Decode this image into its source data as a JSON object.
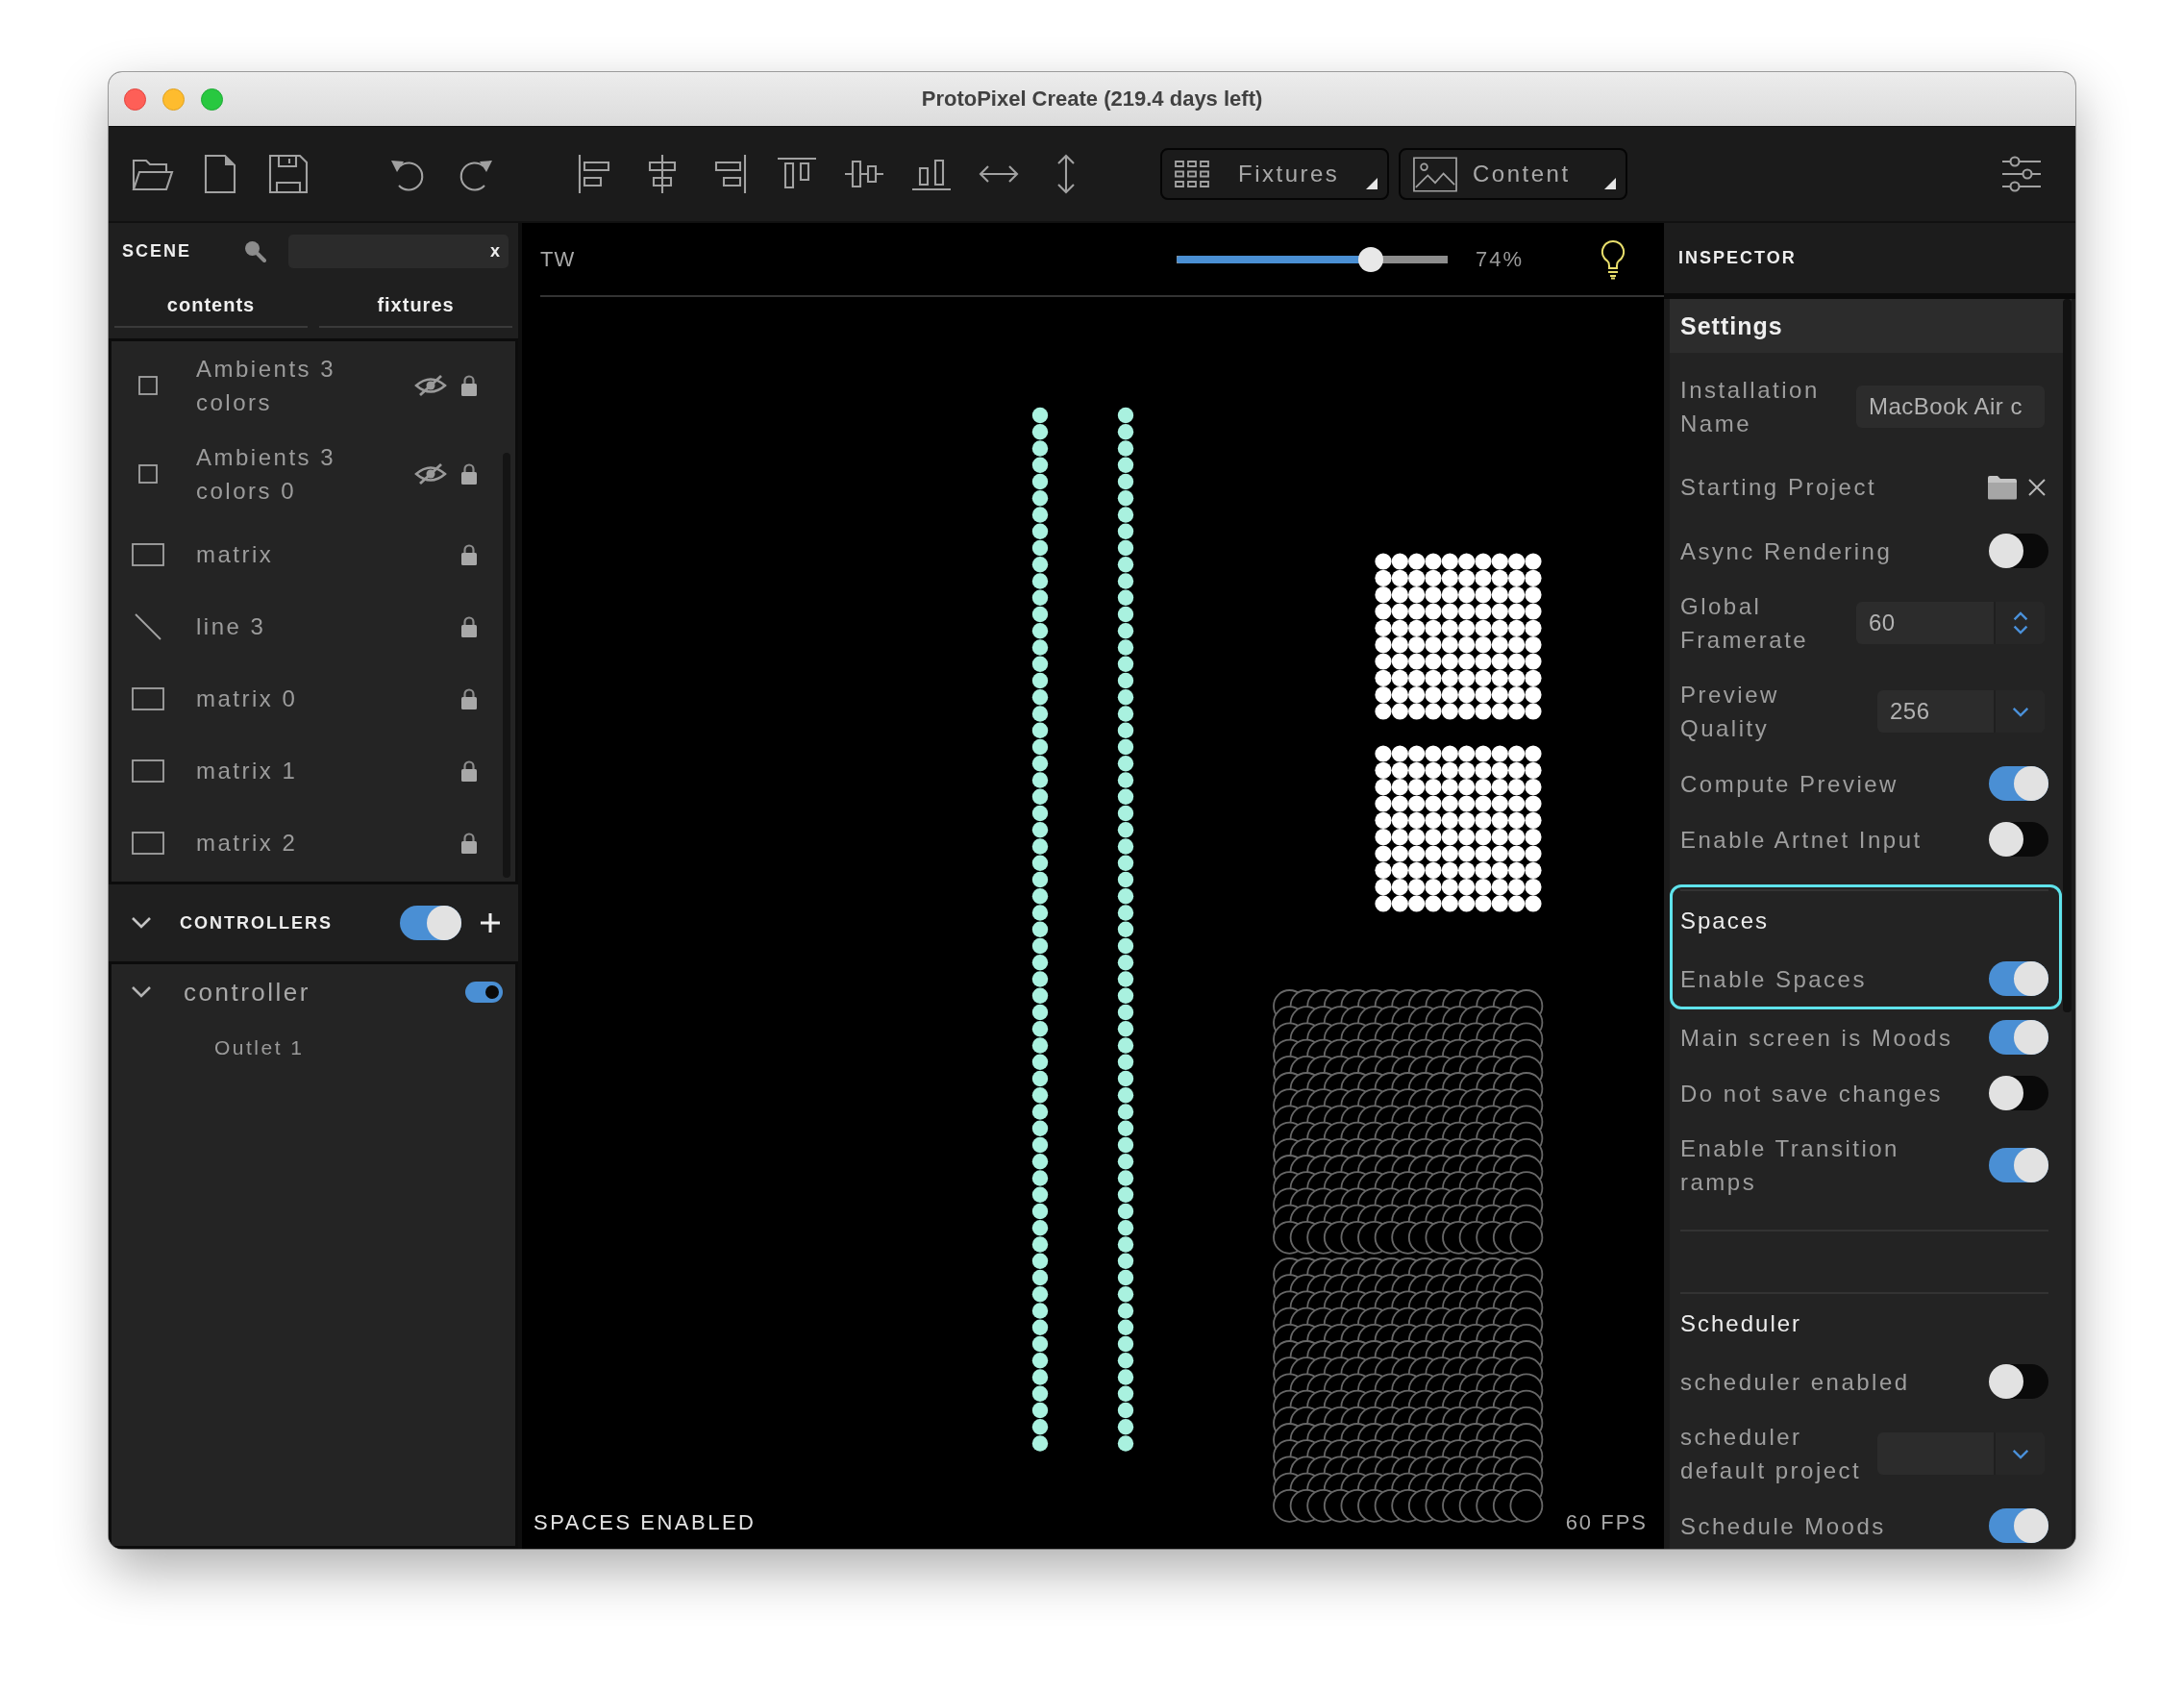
{
  "window": {
    "title": "ProtoPixel Create (219.4 days left)"
  },
  "toolbar": {
    "menus": [
      {
        "label": "Fixtures",
        "kind": "fixtures"
      },
      {
        "label": "Content",
        "kind": "content"
      }
    ]
  },
  "scene": {
    "title": "SCENE",
    "search": {
      "clear": "x"
    },
    "tabs": [
      {
        "label": "contents"
      },
      {
        "label": "fixtures"
      }
    ],
    "items": [
      {
        "name": "Ambients 3 colors",
        "kind": "ambient",
        "hidden": true,
        "locked": true
      },
      {
        "name": "Ambients 3 colors 0",
        "kind": "ambient",
        "hidden": true,
        "locked": true
      },
      {
        "name": "matrix",
        "kind": "matrix",
        "hidden": false,
        "locked": true
      },
      {
        "name": "line 3",
        "kind": "line",
        "hidden": false,
        "locked": true
      },
      {
        "name": "matrix 0",
        "kind": "matrix",
        "hidden": false,
        "locked": true
      },
      {
        "name": "matrix 1",
        "kind": "matrix",
        "hidden": false,
        "locked": true
      },
      {
        "name": "matrix 2",
        "kind": "matrix",
        "hidden": false,
        "locked": true
      }
    ]
  },
  "controllers": {
    "title": "CONTROLLERS",
    "expanded": true,
    "on": true,
    "items": [
      {
        "name": "controller",
        "expanded": true,
        "on": true,
        "outlets": [
          "Outlet 1"
        ]
      }
    ]
  },
  "canvas": {
    "title": "TW",
    "brightness": {
      "level": 0.74,
      "reading": "74%"
    },
    "status": "SPACES ENABLED",
    "fps": "60 FPS"
  },
  "inspector": {
    "title": "INSPECTOR",
    "sections": [
      {
        "kind": "bar",
        "title": "Settings",
        "rows": [
          {
            "label": "Installation Name",
            "kind": "text",
            "value": "MacBook Air c"
          },
          {
            "label": "Starting Project",
            "kind": "file"
          },
          {
            "label": "Async Rendering",
            "kind": "toggle",
            "on": false
          },
          {
            "label": "Global Framerate",
            "kind": "number",
            "value": "60"
          },
          {
            "label": "Preview Quality",
            "kind": "select",
            "value": "256"
          },
          {
            "label": "Compute Preview",
            "kind": "toggle",
            "on": true
          },
          {
            "label": "Enable Artnet Input",
            "kind": "toggle",
            "on": false
          }
        ]
      },
      {
        "kind": "group",
        "title": "Spaces",
        "highlighted": true,
        "rows": [
          {
            "label": "Enable Spaces",
            "kind": "toggle",
            "on": true
          }
        ]
      },
      {
        "kind": "plain",
        "rows": [
          {
            "label": "Main screen is Moods",
            "kind": "toggle",
            "on": true
          },
          {
            "label": "Do not save changes",
            "kind": "toggle",
            "on": false
          },
          {
            "label": "Enable Transition ramps",
            "kind": "toggle",
            "on": true
          }
        ]
      },
      {
        "kind": "group",
        "title": "Scheduler",
        "highlighted": false,
        "separator": true,
        "rows": [
          {
            "label": "scheduler enabled",
            "kind": "toggle",
            "on": false
          },
          {
            "label": "scheduler default project",
            "kind": "select"
          },
          {
            "label": "Schedule Moods",
            "kind": "toggle",
            "on": true
          }
        ]
      }
    ]
  }
}
